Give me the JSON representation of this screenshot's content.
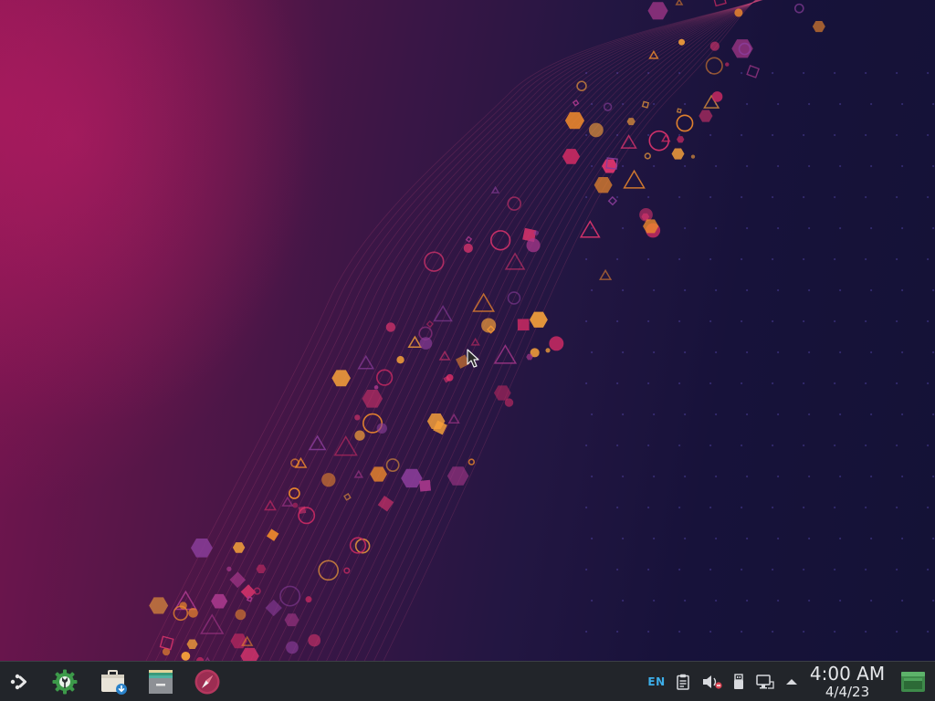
{
  "taskbar": {
    "launchers": [
      {
        "name": "application-launcher",
        "icon": "steamdeck-launcher-icon"
      },
      {
        "name": "system-settings",
        "icon": "wrench-gear-icon"
      },
      {
        "name": "discover-store",
        "icon": "briefcase-download-icon"
      },
      {
        "name": "ark-archiver",
        "icon": "archive-box-icon"
      },
      {
        "name": "web-browser",
        "icon": "compass-icon"
      }
    ],
    "tray": {
      "keyboard_layout": "EN",
      "icons": [
        "clipboard-icon",
        "volume-muted-icon",
        "usb-device-icon",
        "network-wired-icon",
        "expand-tray-arrow-icon"
      ]
    },
    "clock": {
      "time": "4:00 AM",
      "date": "4/4/23"
    },
    "show_desktop_icon": "show-desktop-icon"
  },
  "colors": {
    "taskbar_bg": "#22252a",
    "accent": "#3daee9",
    "settings_green": "#3d9a4a",
    "browser_red": "#b4375e"
  }
}
